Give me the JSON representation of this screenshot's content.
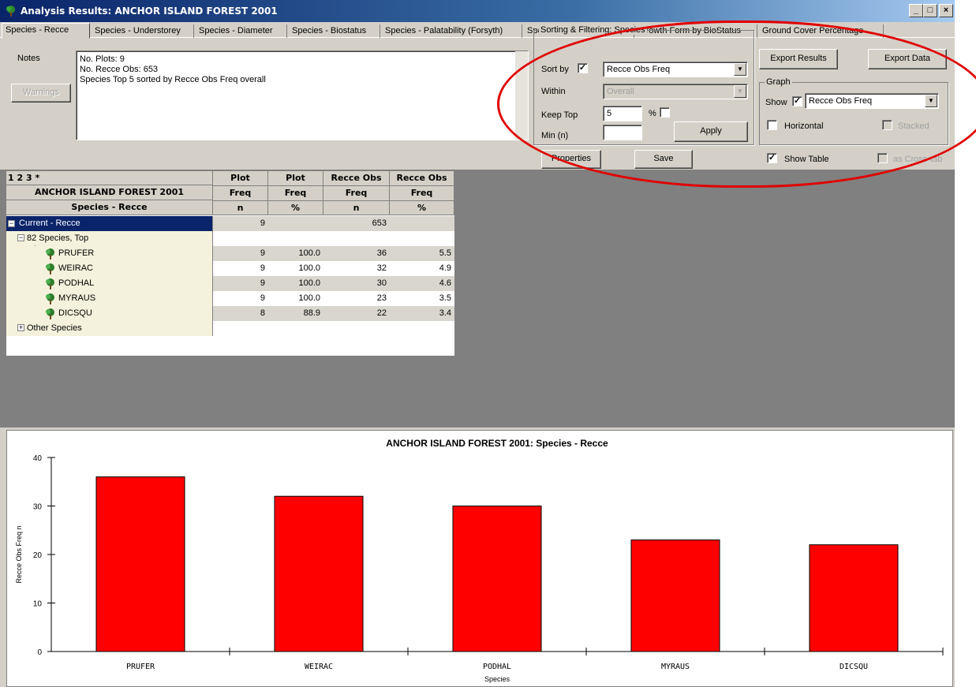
{
  "window": {
    "title": "Analysis Results: ANCHOR ISLAND FOREST 2001",
    "minimize": "_",
    "maximize": "□",
    "close": "×"
  },
  "tabs": [
    {
      "label": "Species - Recce",
      "active": true
    },
    {
      "label": "Species - Understorey"
    },
    {
      "label": "Species - Diameter"
    },
    {
      "label": "Species - Biostatus"
    },
    {
      "label": "Species - Palatability (Forsyth)"
    },
    {
      "label": "Species - Growth Form"
    },
    {
      "label": "Growth Form by BioStatus"
    },
    {
      "label": "Ground Cover Percentage"
    }
  ],
  "notes": {
    "label": "Notes",
    "warnings_button": "Warnings",
    "lines": [
      "No. Plots: 9",
      "No. Recce Obs: 653",
      "Species Top 5 sorted by Recce Obs Freq overall"
    ]
  },
  "sorting": {
    "group_title": "Sorting & Filtering: Species",
    "sort_by_label": "Sort by",
    "sort_by_checked": true,
    "sort_by_value": "Recce Obs Freq",
    "within_label": "Within",
    "within_value": "Overall",
    "keep_top_label": "Keep Top",
    "keep_top_value": "5",
    "percent_label": "%",
    "min_label": "Min (n)",
    "min_value": "",
    "apply_button": "Apply"
  },
  "buttons": {
    "properties": "Properties",
    "save": "Save",
    "export_results": "Export Results",
    "export_data": "Export Data"
  },
  "graph": {
    "group_title": "Graph",
    "show_label": "Show",
    "show_checked": true,
    "show_value": "Recce Obs Freq",
    "horizontal_label": "Horizontal",
    "stacked_label": "Stacked",
    "show_table_label": "Show Table",
    "show_table_checked": true,
    "cross_tab_label": "as Cross-tab"
  },
  "grid": {
    "levels": [
      "1",
      "2",
      "3",
      "*"
    ],
    "title": "ANCHOR ISLAND FOREST 2001",
    "subtitle": "Species - Recce",
    "columns": [
      {
        "h1": "Plot",
        "h2": "Freq",
        "h3": "n"
      },
      {
        "h1": "Plot",
        "h2": "Freq",
        "h3": "%"
      },
      {
        "h1": "Recce Obs",
        "h2": "Freq",
        "h3": "n"
      },
      {
        "h1": "Recce Obs",
        "h2": "Freq",
        "h3": "%"
      }
    ],
    "current": {
      "label": "Current - Recce",
      "plot_n": "9",
      "obs_n": "653"
    },
    "top_group": "82 Species, Top",
    "rows": [
      {
        "species": "PRUFER",
        "plot_n": "9",
        "plot_pct": "100.0",
        "obs_n": "36",
        "obs_pct": "5.5"
      },
      {
        "species": "WEIRAC",
        "plot_n": "9",
        "plot_pct": "100.0",
        "obs_n": "32",
        "obs_pct": "4.9"
      },
      {
        "species": "PODHAL",
        "plot_n": "9",
        "plot_pct": "100.0",
        "obs_n": "30",
        "obs_pct": "4.6"
      },
      {
        "species": "MYRAUS",
        "plot_n": "9",
        "plot_pct": "100.0",
        "obs_n": "23",
        "obs_pct": "3.5"
      },
      {
        "species": "DICSQU",
        "plot_n": "8",
        "plot_pct": "88.9",
        "obs_n": "22",
        "obs_pct": "3.4"
      }
    ],
    "other": "Other Species"
  },
  "colors": {
    "bar": "#ff0000",
    "annotation": "#e00000",
    "selection": "#0a246a"
  },
  "chart_data": {
    "type": "bar",
    "title": "ANCHOR ISLAND FOREST 2001: Species - Recce",
    "xlabel": "Species",
    "ylabel": "Recce Obs Freq n",
    "categories": [
      "PRUFER",
      "WEIRAC",
      "PODHAL",
      "MYRAUS",
      "DICSQU"
    ],
    "values": [
      36,
      32,
      30,
      23,
      22
    ],
    "ylim": [
      0,
      40
    ],
    "yticks": [
      "0",
      "10",
      "20",
      "30",
      "40"
    ],
    "grid": false,
    "legend": "none"
  }
}
